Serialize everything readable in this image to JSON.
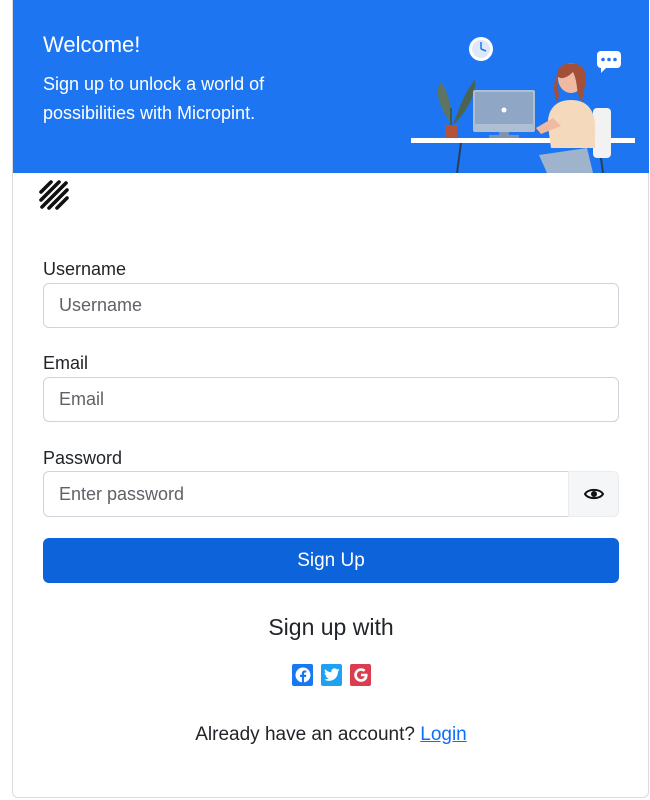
{
  "banner": {
    "title": "Welcome!",
    "subtitle": "Sign up to unlock a world of possibilities with Micropint."
  },
  "form": {
    "username_label": "Username",
    "username_placeholder": "Username",
    "username_value": "",
    "email_label": "Email",
    "email_placeholder": "Email",
    "email_value": "",
    "password_label": "Password",
    "password_placeholder": "Enter password",
    "password_value": "",
    "submit_label": "Sign Up"
  },
  "social": {
    "heading": "Sign up with",
    "providers": [
      "facebook-icon",
      "twitter-icon",
      "google-icon"
    ]
  },
  "footer": {
    "prompt": "Already have an account?",
    "login_label": "Login"
  },
  "colors": {
    "banner": "#1d75f2",
    "primary_button": "#0d63da",
    "facebook": "#1877f2",
    "twitter": "#1da1f2",
    "google": "#db3d4e",
    "link": "#0d6efd"
  }
}
